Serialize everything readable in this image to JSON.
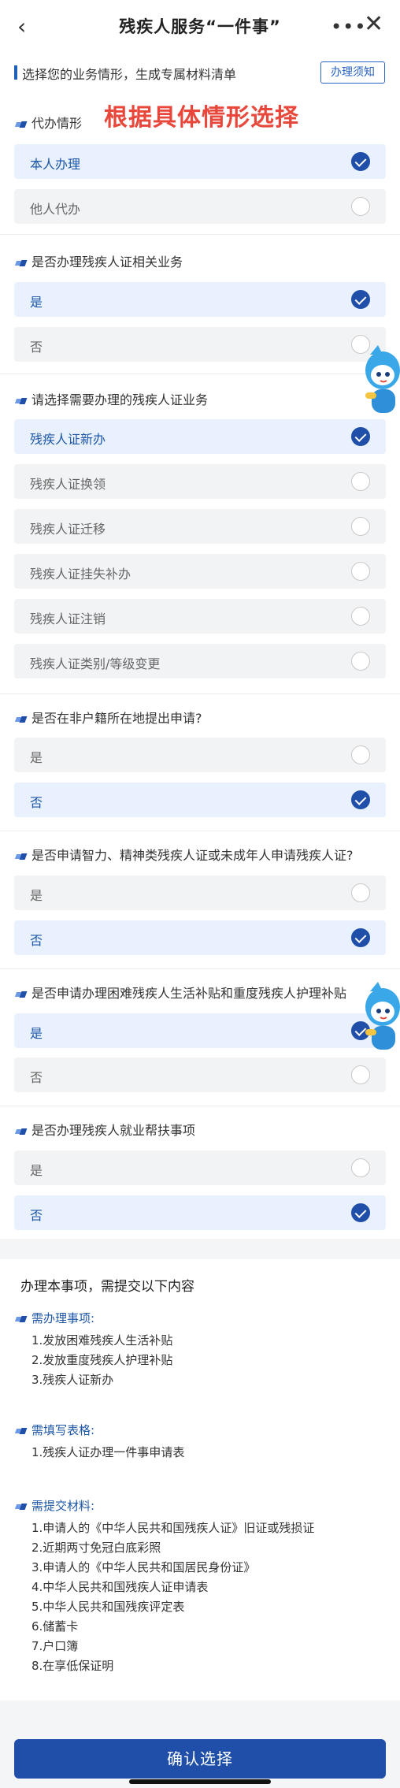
{
  "header": {
    "title": "残疾人服务“一件事”",
    "back_icon": "chevron-left-icon",
    "more_icon": "more-dots-icon",
    "close_icon": "close-icon"
  },
  "intro": {
    "text": "选择您的业务情形，生成专属材料清单",
    "guide_button": "办理须知"
  },
  "hint": "根据具体情形选择",
  "questions": [
    {
      "title": "代办情形",
      "options": [
        {
          "label": "本人办理",
          "selected": true
        },
        {
          "label": "他人代办",
          "selected": false
        }
      ]
    },
    {
      "title": "是否办理残疾人证相关业务",
      "options": [
        {
          "label": "是",
          "selected": true
        },
        {
          "label": "否",
          "selected": false
        }
      ]
    },
    {
      "title": "请选择需要办理的残疾人证业务",
      "options": [
        {
          "label": "残疾人证新办",
          "selected": true
        },
        {
          "label": "残疾人证换领",
          "selected": false
        },
        {
          "label": "残疾人证迁移",
          "selected": false
        },
        {
          "label": "残疾人证挂失补办",
          "selected": false
        },
        {
          "label": "残疾人证注销",
          "selected": false
        },
        {
          "label": "残疾人证类别/等级变更",
          "selected": false
        }
      ]
    },
    {
      "title": "是否在非户籍所在地提出申请?",
      "options": [
        {
          "label": "是",
          "selected": false
        },
        {
          "label": "否",
          "selected": true
        }
      ]
    },
    {
      "title": "是否申请智力、精神类残疾人证或未成年人申请残疾人证?",
      "options": [
        {
          "label": "是",
          "selected": false
        },
        {
          "label": "否",
          "selected": true
        }
      ]
    },
    {
      "title": "是否申请办理困难残疾人生活补贴和重度残疾人护理补贴",
      "options": [
        {
          "label": "是",
          "selected": true
        },
        {
          "label": "否",
          "selected": false
        }
      ]
    },
    {
      "title": "是否办理残疾人就业帮扶事项",
      "options": [
        {
          "label": "是",
          "selected": false
        },
        {
          "label": "否",
          "selected": true
        }
      ]
    }
  ],
  "summary": {
    "title": "办理本事项，需提交以下内容",
    "matters_title": "需办理事项:",
    "matters": [
      "1.发放困难残疾人生活补贴",
      "2.发放重度残疾人护理补贴",
      "3.残疾人证新办"
    ],
    "forms_title": "需填写表格:",
    "forms": [
      "1.残疾人证办理一件事申请表"
    ],
    "materials_title": "需提交材料:",
    "materials": [
      "1.申请人的《中华人民共和国残疾人证》旧证或残损证",
      "2.近期两寸免冠白底彩照",
      "3.申请人的《中华人民共和国居民身份证》",
      "4.中华人民共和国残疾人证申请表",
      "5.中华人民共和国残疾评定表",
      "6.储蓄卡",
      "7.户口簿",
      "8.在享低保证明"
    ]
  },
  "confirm_button": "确认选择",
  "colors": {
    "accent": "#1f4fa8",
    "hint": "#e8473c",
    "selected_bg": "#e8f1fd"
  }
}
